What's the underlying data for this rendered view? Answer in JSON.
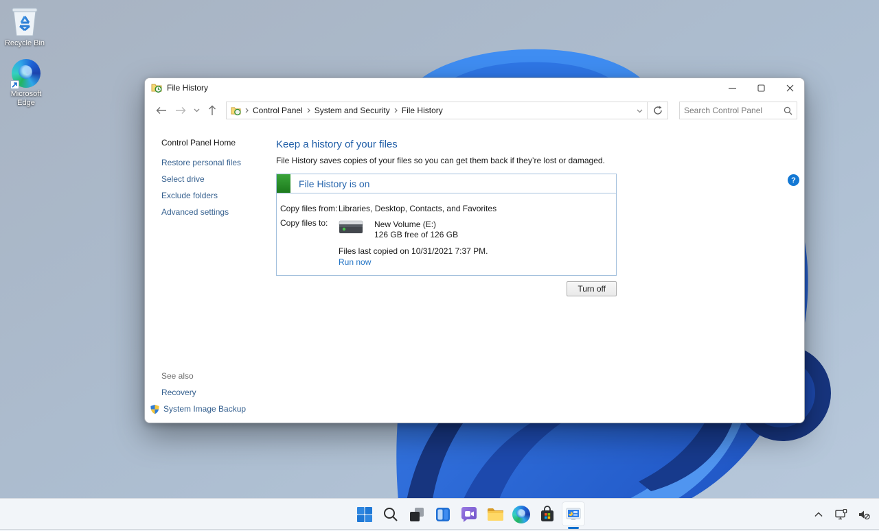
{
  "titlebar": {
    "title": "File History"
  },
  "toolbar": {
    "breadcrumb": [
      "Control Panel",
      "System and Security",
      "File History"
    ],
    "search_placeholder": "Search Control Panel"
  },
  "sidebar": {
    "home": "Control Panel Home",
    "links": [
      "Restore personal files",
      "Select drive",
      "Exclude folders",
      "Advanced settings"
    ],
    "see_also": "See also",
    "recovery": "Recovery",
    "system_image_backup": "System Image Backup"
  },
  "main": {
    "heading": "Keep a history of your files",
    "description": "File History saves copies of your files so you can get them back if they’re lost or damaged.",
    "status_title": "File History is on",
    "copy_from_label": "Copy files from:",
    "copy_from_value": "Libraries, Desktop, Contacts, and Favorites",
    "copy_to_label": "Copy files to:",
    "drive_name": "New Volume (E:)",
    "drive_space": "126 GB free of 126 GB",
    "last_copied": "Files last copied on 10/31/2021 7:37 PM.",
    "run_now": "Run now",
    "turn_off": "Turn off",
    "help_glyph": "?"
  },
  "desktop": {
    "icon_labels": [
      "Recycle Bin",
      "Microsoft Edge"
    ]
  },
  "colors": {
    "heading_blue": "#1d5ca6",
    "status_blue": "#2766ad",
    "link_blue": "#35608f",
    "run_now_blue": "#2273c4",
    "green_on": "#2f9e31",
    "taskbar_underline": "#1070ce"
  }
}
